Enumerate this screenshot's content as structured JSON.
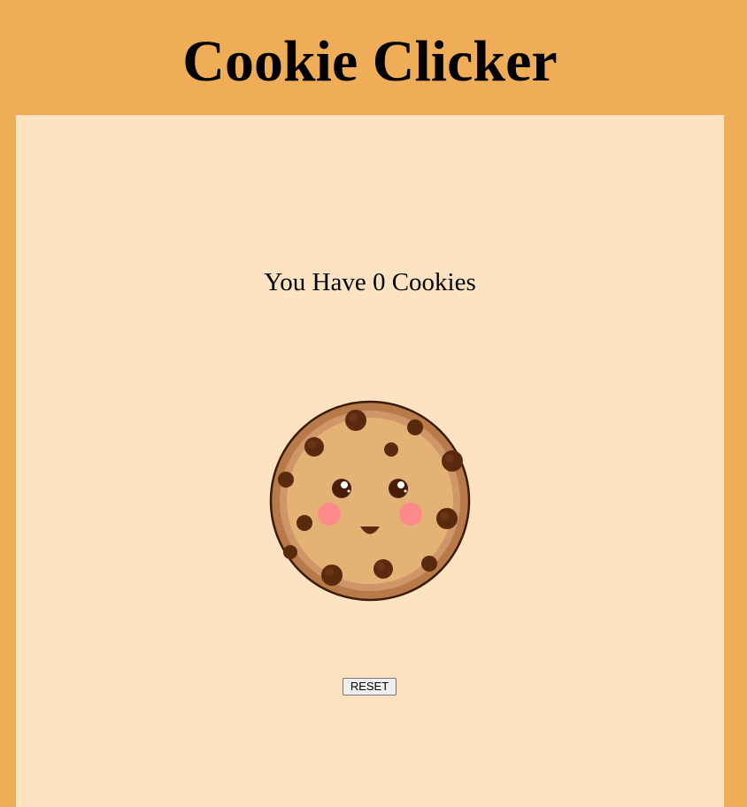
{
  "app": {
    "title": "Cookie Clicker"
  },
  "counter": {
    "text": "You Have 0 Cookies",
    "count": 0
  },
  "cookie": {
    "icon": "cookie-icon"
  },
  "controls": {
    "reset_label": "RESET"
  },
  "colors": {
    "background": "#f0ad58",
    "panel": "#fee3c3"
  }
}
